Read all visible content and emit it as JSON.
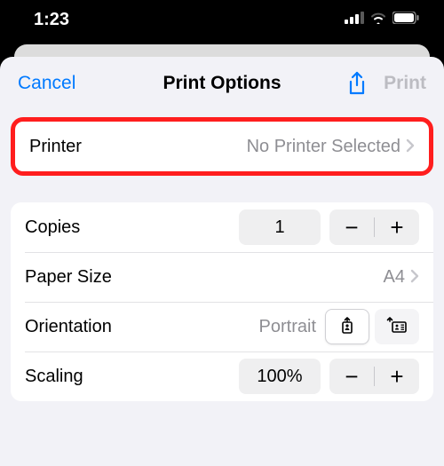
{
  "status": {
    "time": "1:23"
  },
  "nav": {
    "cancel": "Cancel",
    "title": "Print Options",
    "print": "Print"
  },
  "printer": {
    "label": "Printer",
    "value": "No Printer Selected"
  },
  "copies": {
    "label": "Copies",
    "value": "1"
  },
  "paper": {
    "label": "Paper Size",
    "value": "A4"
  },
  "orientation": {
    "label": "Orientation",
    "value": "Portrait"
  },
  "scaling": {
    "label": "Scaling",
    "value": "100%"
  },
  "colors": {
    "accent": "#007aff"
  }
}
